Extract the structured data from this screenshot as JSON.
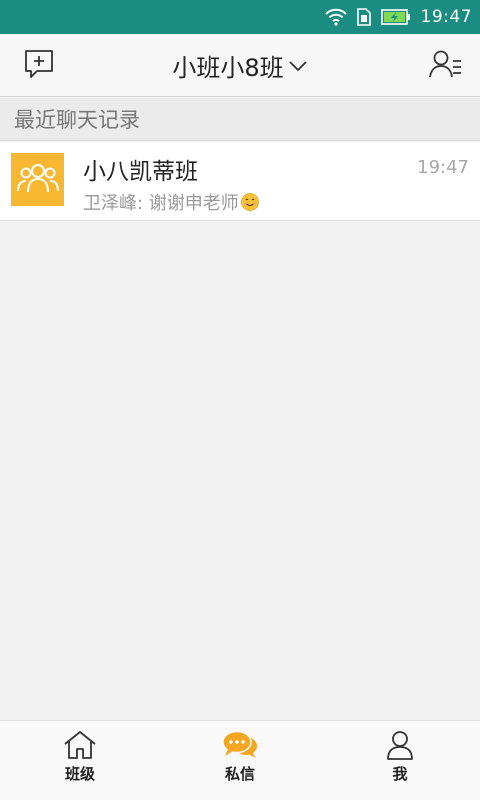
{
  "statusbar": {
    "time": "19:47",
    "icons": [
      "wifi-icon",
      "sim-card-icon",
      "battery-charging-icon"
    ]
  },
  "appbar": {
    "left_icon": "new-chat-icon",
    "title": "小班小8班",
    "title_icon": "chevron-down-icon",
    "right_icon": "contacts-list-icon"
  },
  "section": {
    "header": "最近聊天记录"
  },
  "chats": [
    {
      "name": "小八凯蒂班",
      "time": "19:47",
      "preview": "卫泽峰: 谢谢申老师",
      "avatar_icon": "group-icon",
      "avatar_color": "#f7b731",
      "preview_emoji": "smile-emoji-icon"
    }
  ],
  "bottom_nav": {
    "active_color": "#f5a623",
    "items": [
      {
        "label": "班级",
        "icon": "home-icon",
        "active": false
      },
      {
        "label": "私信",
        "icon": "chat-bubbles-icon",
        "active": true
      },
      {
        "label": "我",
        "icon": "person-icon",
        "active": false
      }
    ]
  },
  "colors": {
    "statusbar_bg": "#1a8c82",
    "accent": "#f5a623"
  }
}
